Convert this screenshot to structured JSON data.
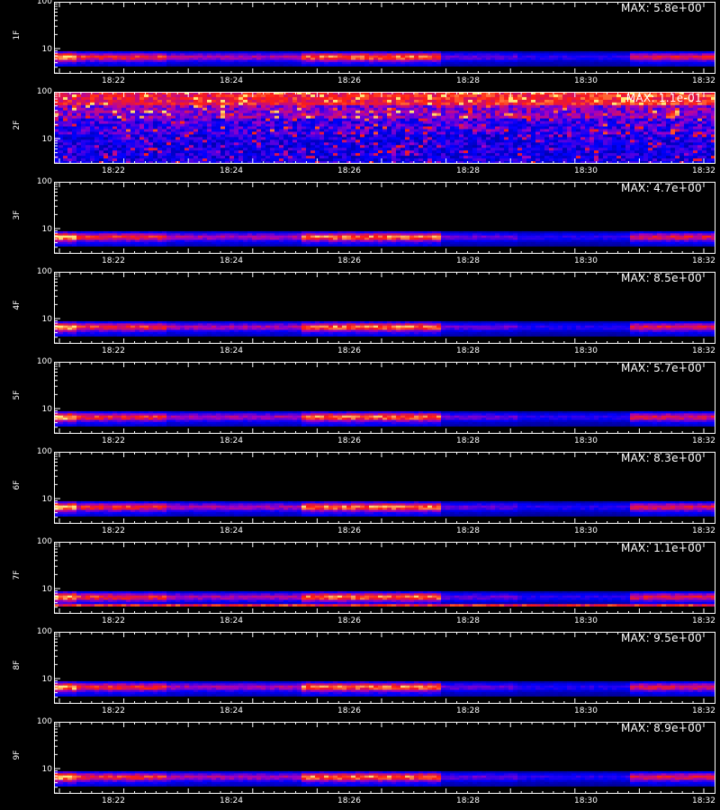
{
  "chart_data": [
    {
      "type": "heatmap",
      "channel": "1F",
      "max_label": "MAX: 5.8e+00",
      "y_tick_labels": [
        "100",
        "10"
      ],
      "x_tick_labels": [
        "18:22",
        "18:24",
        "18:26",
        "18:28",
        "18:30",
        "18:32"
      ]
    },
    {
      "type": "heatmap",
      "channel": "2F",
      "max_label": "MAX: 1.1e-01",
      "y_tick_labels": [
        "100",
        "10"
      ],
      "x_tick_labels": [
        "18:22",
        "18:24",
        "18:26",
        "18:28",
        "18:30",
        "18:32"
      ]
    },
    {
      "type": "heatmap",
      "channel": "3F",
      "max_label": "MAX: 4.7e+00",
      "y_tick_labels": [
        "100",
        "10"
      ],
      "x_tick_labels": [
        "18:22",
        "18:24",
        "18:26",
        "18:28",
        "18:30",
        "18:32"
      ]
    },
    {
      "type": "heatmap",
      "channel": "4F",
      "max_label": "MAX: 8.5e+00",
      "y_tick_labels": [
        "100",
        "10"
      ],
      "x_tick_labels": [
        "18:22",
        "18:24",
        "18:26",
        "18:28",
        "18:30",
        "18:32"
      ]
    },
    {
      "type": "heatmap",
      "channel": "5F",
      "max_label": "MAX: 5.7e+00",
      "y_tick_labels": [
        "100",
        "10"
      ],
      "x_tick_labels": [
        "18:22",
        "18:24",
        "18:26",
        "18:28",
        "18:30",
        "18:32"
      ]
    },
    {
      "type": "heatmap",
      "channel": "6F",
      "max_label": "MAX: 8.3e+00",
      "y_tick_labels": [
        "100",
        "10"
      ],
      "x_tick_labels": [
        "18:22",
        "18:24",
        "18:26",
        "18:28",
        "18:30",
        "18:32"
      ]
    },
    {
      "type": "heatmap",
      "channel": "7F",
      "max_label": "MAX: 1.1e+00",
      "y_tick_labels": [
        "100",
        "10"
      ],
      "x_tick_labels": [
        "18:22",
        "18:24",
        "18:26",
        "18:28",
        "18:30",
        "18:32"
      ]
    },
    {
      "type": "heatmap",
      "channel": "8F",
      "max_label": "MAX: 9.5e+00",
      "y_tick_labels": [
        "100",
        "10"
      ],
      "x_tick_labels": [
        "18:22",
        "18:24",
        "18:26",
        "18:28",
        "18:30",
        "18:32"
      ]
    },
    {
      "type": "heatmap",
      "channel": "9F",
      "max_label": "MAX: 8.9e+00",
      "y_tick_labels": [
        "100",
        "10"
      ],
      "x_tick_labels": [
        "18:22",
        "18:24",
        "18:26",
        "18:28",
        "18:30",
        "18:32"
      ]
    }
  ],
  "colors": {
    "background": "#000000",
    "axis": "#ffffff",
    "low": "#1a1aff",
    "mid": "#ff1a1a",
    "high": "#ffe680"
  }
}
